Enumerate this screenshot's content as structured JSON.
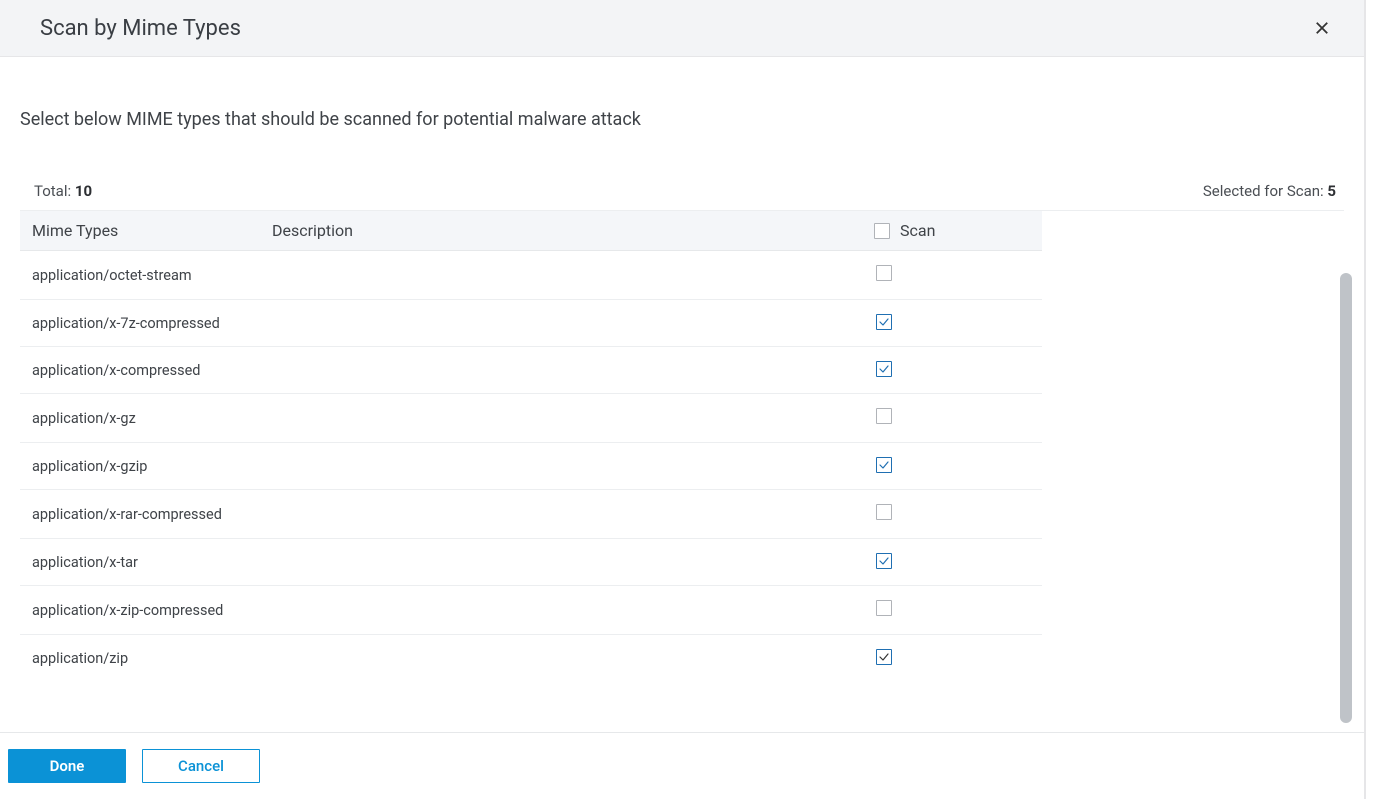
{
  "header": {
    "title": "Scan by Mime Types"
  },
  "body": {
    "instruction": "Select below MIME types that should be scanned for potential malware attack",
    "total_label": "Total:",
    "total_value": "10",
    "selected_label": "Selected for Scan:",
    "selected_value": "5"
  },
  "table": {
    "columns": {
      "mime": "Mime Types",
      "description": "Description",
      "scan": "Scan"
    },
    "header_checked": false,
    "rows": [
      {
        "mime": "application/octet-stream",
        "description": "",
        "checked": false
      },
      {
        "mime": "application/x-7z-compressed",
        "description": "",
        "checked": true
      },
      {
        "mime": "application/x-compressed",
        "description": "",
        "checked": true
      },
      {
        "mime": "application/x-gz",
        "description": "",
        "checked": false
      },
      {
        "mime": "application/x-gzip",
        "description": "",
        "checked": true
      },
      {
        "mime": "application/x-rar-compressed",
        "description": "",
        "checked": false
      },
      {
        "mime": "application/x-tar",
        "description": "",
        "checked": true
      },
      {
        "mime": "application/x-zip-compressed",
        "description": "",
        "checked": false
      },
      {
        "mime": "application/zip",
        "description": "",
        "checked": true,
        "dark": true
      }
    ]
  },
  "footer": {
    "done": "Done",
    "cancel": "Cancel"
  }
}
